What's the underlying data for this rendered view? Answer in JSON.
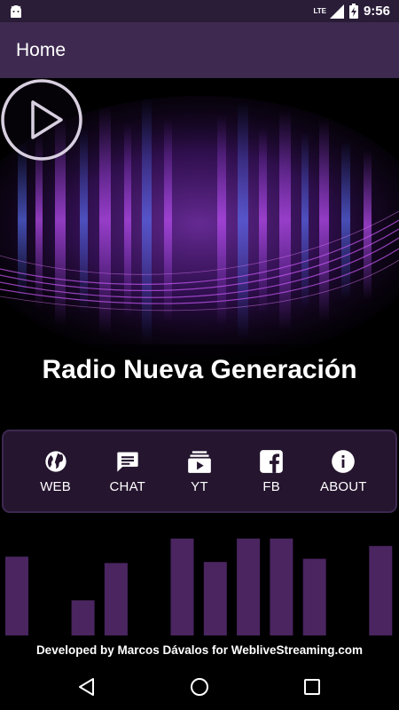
{
  "status_bar": {
    "time": "9:56",
    "network": "LTE",
    "icons": [
      "android-icon",
      "signal-icon",
      "battery-charging-icon"
    ]
  },
  "app_bar": {
    "title": "Home"
  },
  "player": {
    "station_name": "Radio Nueva Generación",
    "play_icon": "play-icon"
  },
  "links": [
    {
      "label": "WEB",
      "icon": "globe-icon"
    },
    {
      "label": "CHAT",
      "icon": "chat-icon"
    },
    {
      "label": "YT",
      "icon": "youtube-icon"
    },
    {
      "label": "FB",
      "icon": "facebook-icon"
    },
    {
      "label": "ABOUT",
      "icon": "info-icon"
    }
  ],
  "equalizer": {
    "levels": [
      0.74,
      0,
      0.33,
      0.68,
      0,
      0.91,
      0.69,
      0.91,
      0.91,
      0.72,
      0,
      0.84
    ]
  },
  "footer": {
    "credit": "Developed by Marcos Dávalos for WebliveStreaming.com"
  },
  "nav_bar": {
    "buttons": [
      "back-icon",
      "home-icon",
      "recents-icon"
    ]
  },
  "colors": {
    "status_bar": "#2a1d38",
    "app_bar": "#3e2a50",
    "panel": "#25152f",
    "accent_purple": "#9b3bd6",
    "bar_fill": "#4a2560"
  }
}
